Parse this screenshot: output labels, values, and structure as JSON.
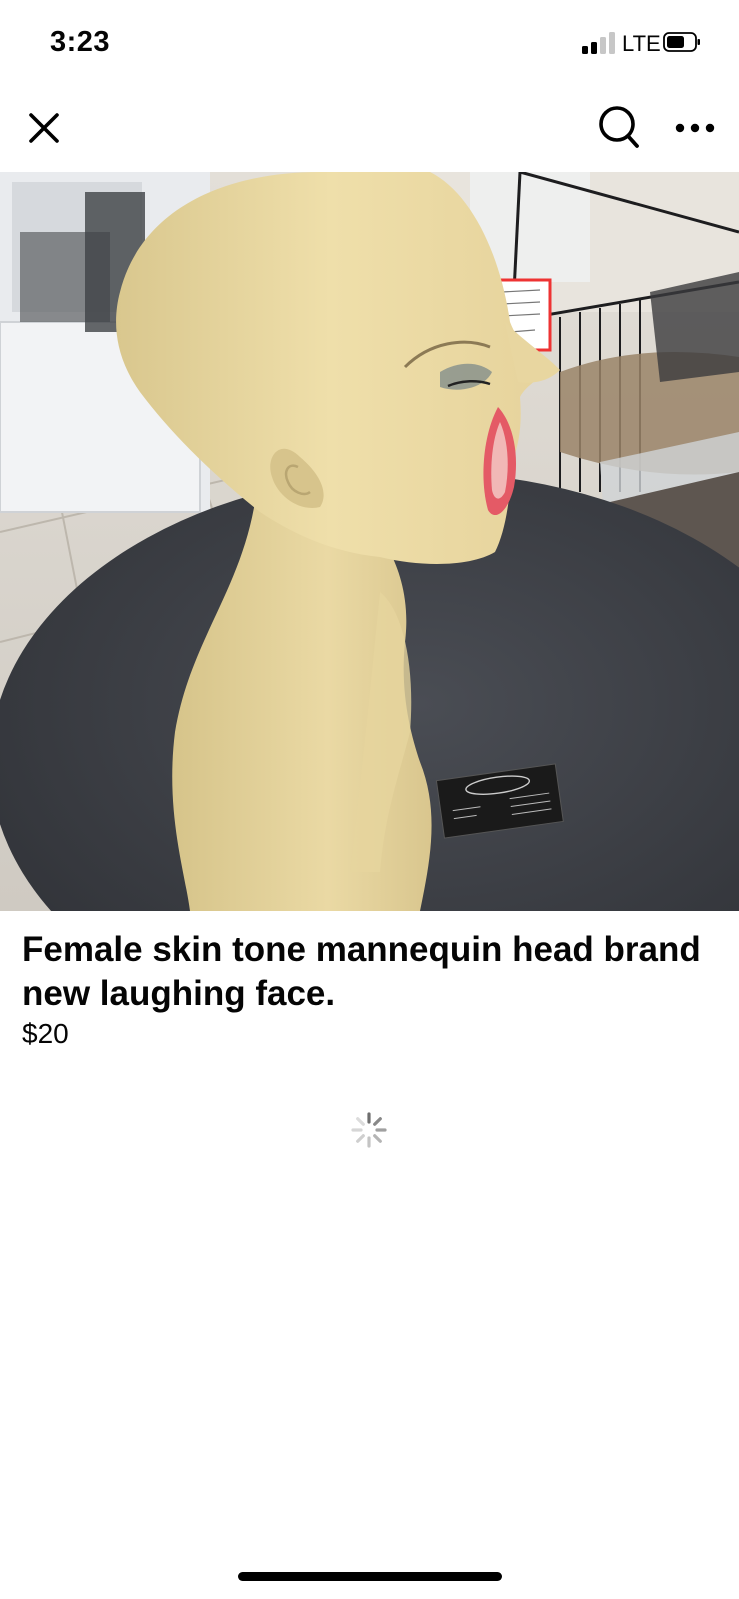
{
  "status_bar": {
    "time": "3:23",
    "network": "LTE",
    "icons": [
      "signal-icon",
      "battery-icon"
    ]
  },
  "nav": {
    "icons": [
      "close-icon",
      "search-icon",
      "more-icon"
    ]
  },
  "listing": {
    "photo_subject": "mannequin-head-photo",
    "title": "Female skin tone mannequin head brand new laughing face.",
    "price": "$20"
  },
  "loading": {
    "icon": "spinner-icon"
  },
  "colors": {
    "text": "#050505",
    "background": "#ffffff",
    "icon_dark": "#000000"
  }
}
